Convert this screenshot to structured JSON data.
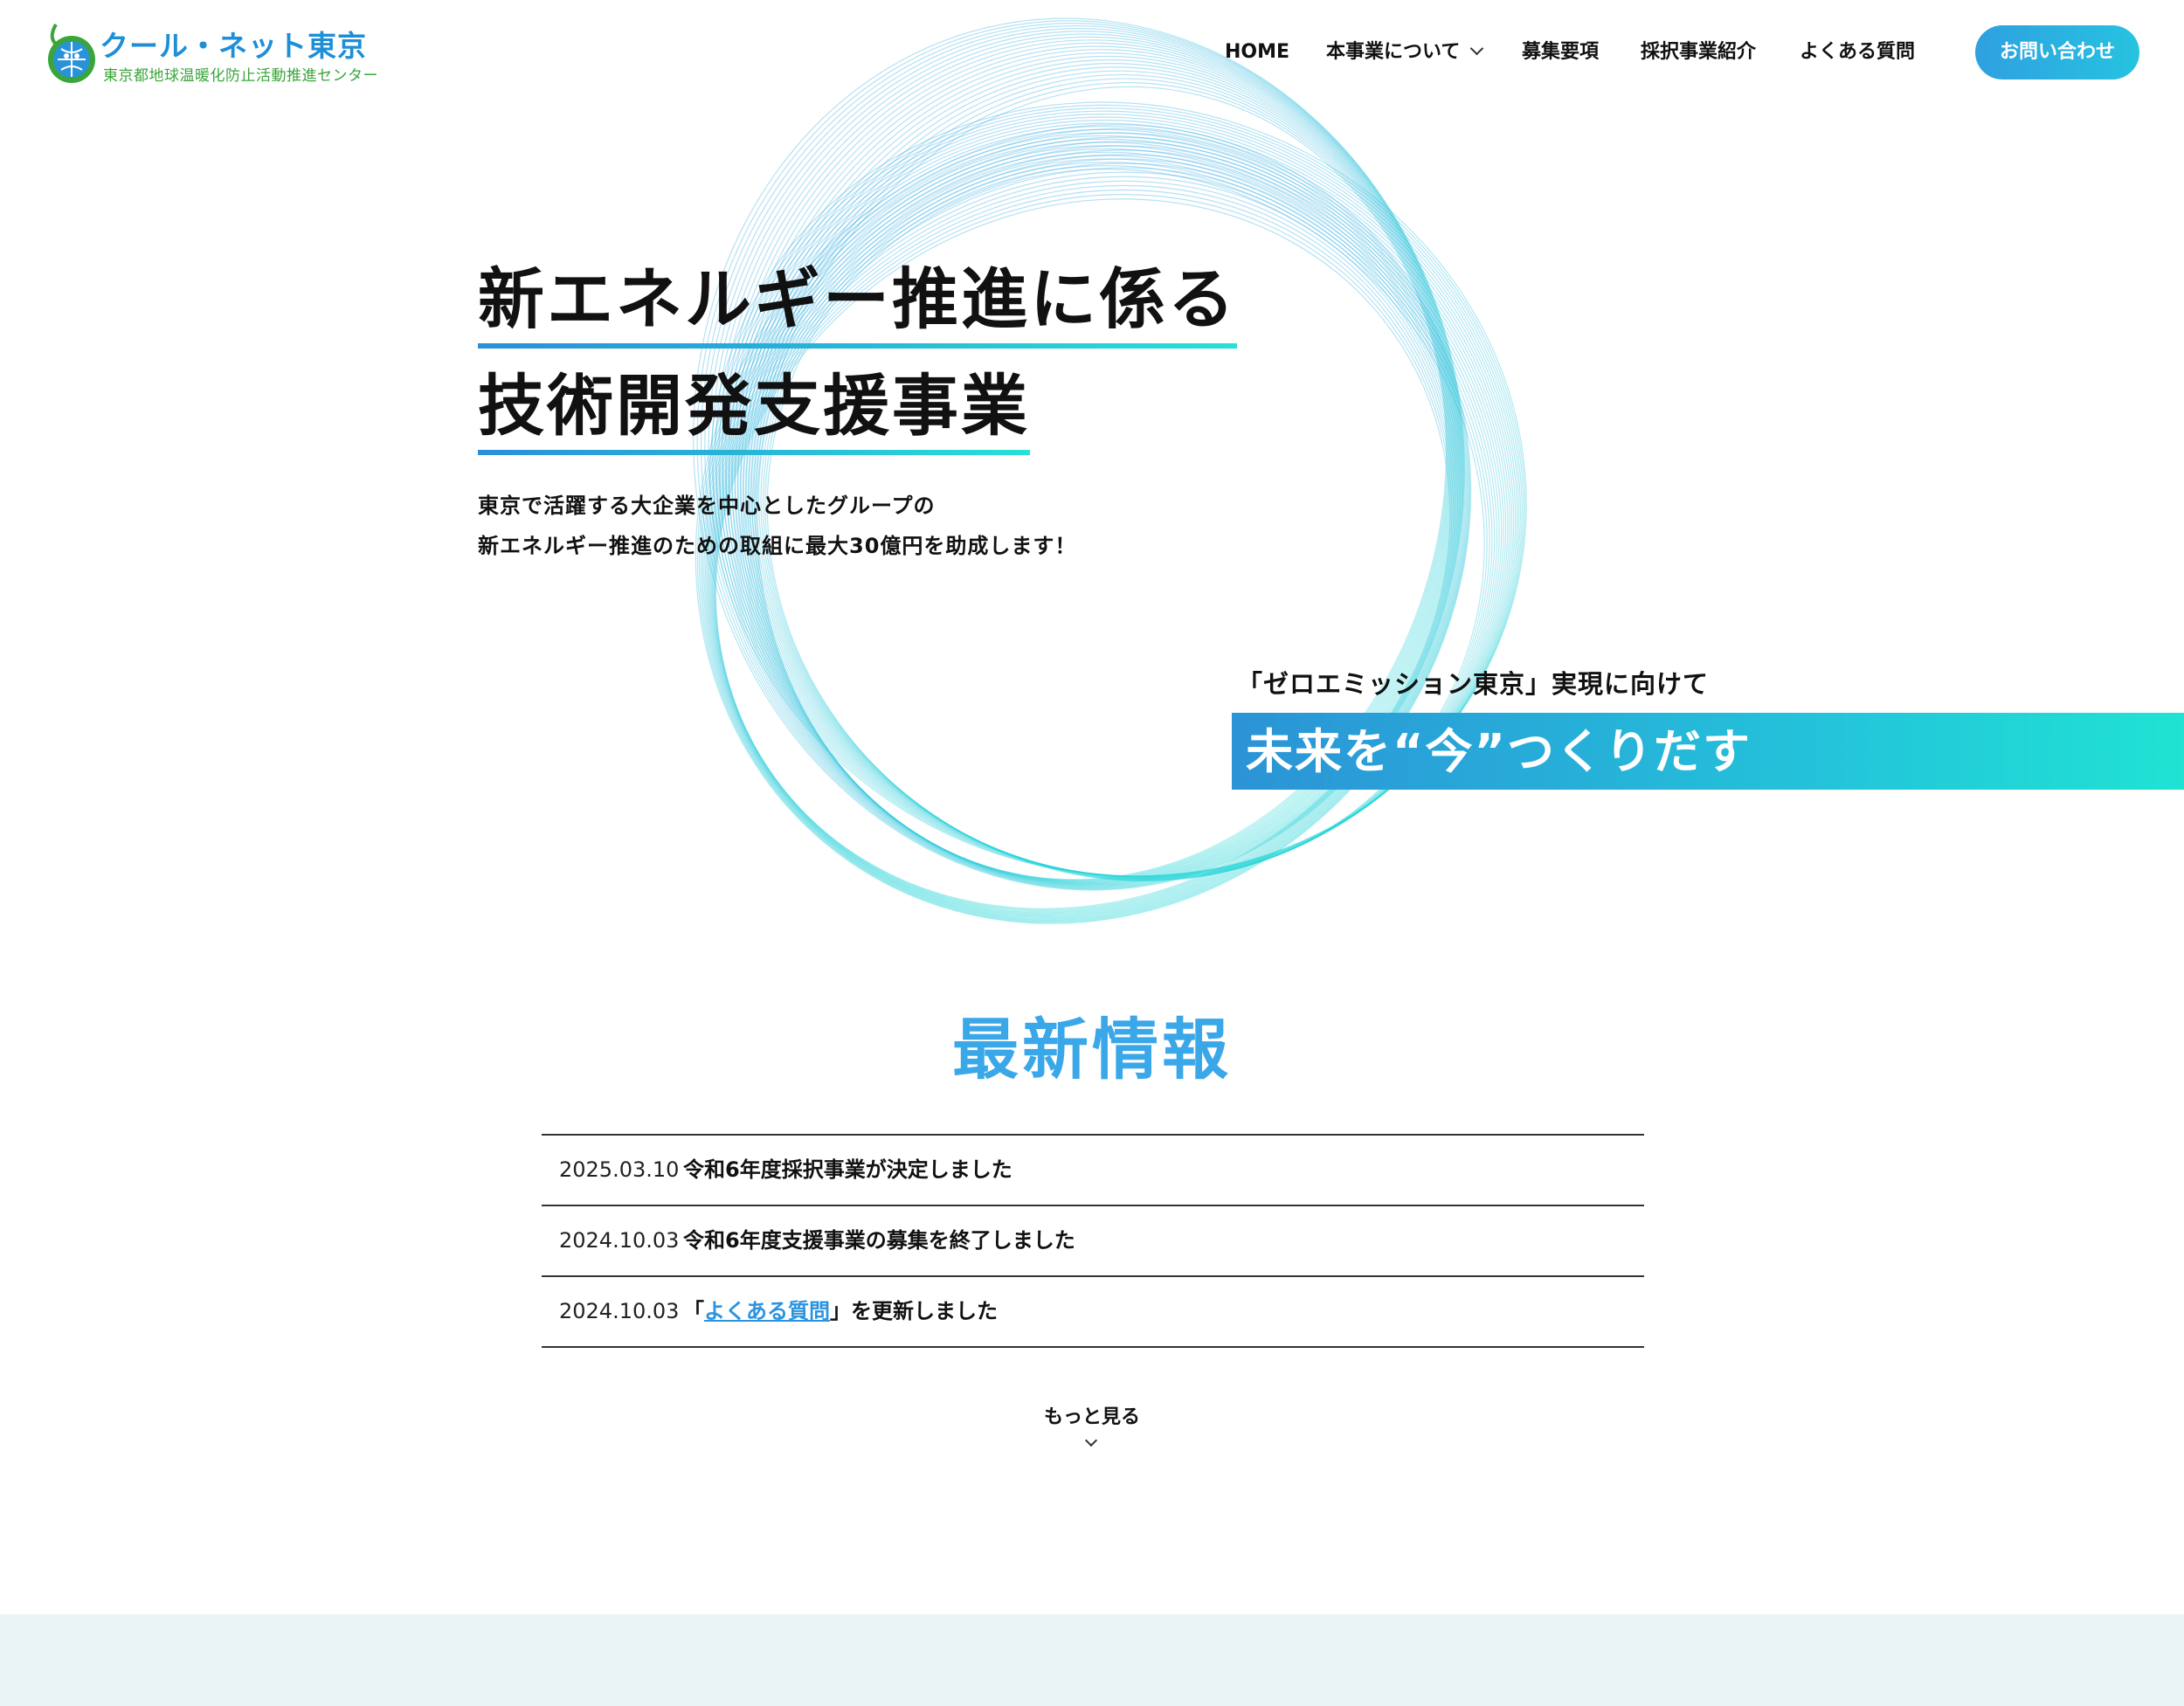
{
  "header": {
    "logo_title": "クール・ネット東京",
    "logo_subtitle": "東京都地球温暖化防止活動推進センター",
    "nav": [
      {
        "label": "HOME"
      },
      {
        "label": "本事業について"
      },
      {
        "label": "募集要項"
      },
      {
        "label": "採択事業紹介"
      },
      {
        "label": "よくある質問"
      }
    ],
    "contact_label": "お問い合わせ"
  },
  "hero": {
    "title_line1": "新エネルギー推進に係る",
    "title_line2": "技術開発支援事業",
    "desc_line1": "東京で活躍する大企業を中心としたグループの",
    "desc_line2": "新エネルギー推進のための取組に最大30億円を助成します！",
    "zero_emission": "「ゼロエミッション東京」実現に向けて",
    "tagline": "未来を“今”つくりだす"
  },
  "news": {
    "title": "最新情報",
    "items": [
      {
        "date": "2025.03.10",
        "text": "令和6年度採択事業が決定しました"
      },
      {
        "date": "2024.10.03",
        "text": "令和6年度支援事業の募集を終了しました"
      },
      {
        "date": "2024.10.03",
        "prefix": "「",
        "link": "よくある質問",
        "suffix": "」を更新しました"
      }
    ],
    "more_label": "もっと見る"
  },
  "colors": {
    "accent": "#2fa0e0",
    "teal": "#1fe3d3",
    "news_title": "#3aa7e8",
    "logo_blue": "#1e8fd6",
    "logo_green": "#3aa53a",
    "footer_band": "#eaf4f6"
  }
}
